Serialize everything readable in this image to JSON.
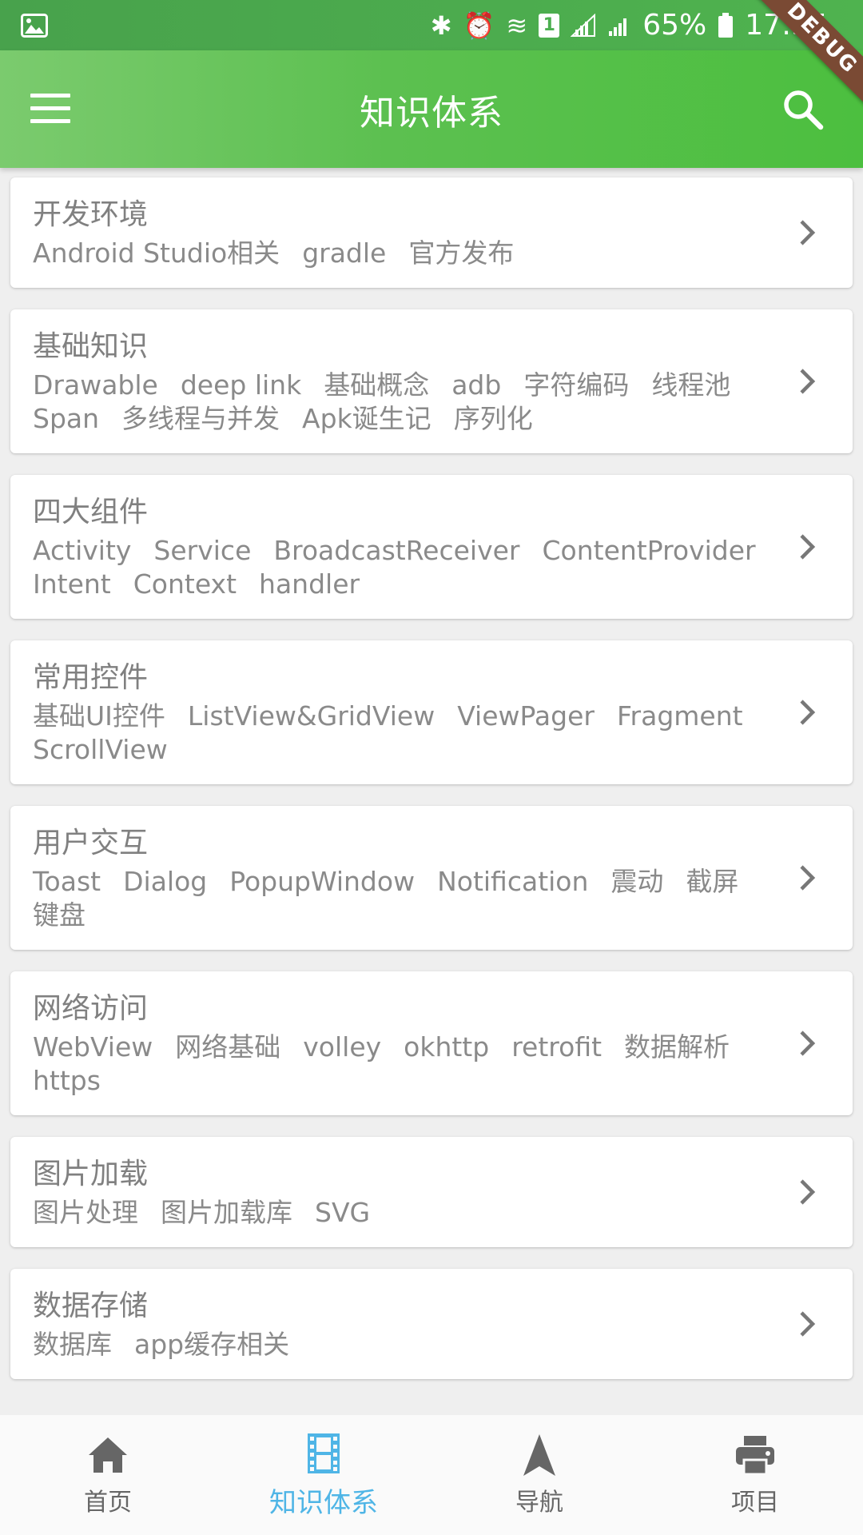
{
  "status_bar": {
    "battery": "65%",
    "time": "17:35",
    "sim_slot": "1"
  },
  "debug_banner": "DEBUG",
  "app_bar": {
    "title": "知识体系"
  },
  "categories": [
    {
      "title": "开发环境",
      "tags": [
        "Android Studio相关",
        "gradle",
        "官方发布"
      ]
    },
    {
      "title": "基础知识",
      "tags": [
        "Drawable",
        "deep link",
        "基础概念",
        "adb",
        "字符编码",
        "线程池",
        "Span",
        "多线程与并发",
        "Apk诞生记",
        "序列化"
      ]
    },
    {
      "title": "四大组件",
      "tags": [
        "Activity",
        "Service",
        "BroadcastReceiver",
        "ContentProvider",
        "Intent",
        "Context",
        "handler"
      ]
    },
    {
      "title": "常用控件",
      "tags": [
        "基础UI控件",
        "ListView&GridView",
        "ViewPager",
        "Fragment",
        "ScrollView"
      ]
    },
    {
      "title": "用户交互",
      "tags": [
        "Toast",
        "Dialog",
        "PopupWindow",
        "Notification",
        "震动",
        "截屏",
        "键盘"
      ]
    },
    {
      "title": "网络访问",
      "tags": [
        "WebView",
        "网络基础",
        "volley",
        "okhttp",
        "retrofit",
        "数据解析",
        "https"
      ]
    },
    {
      "title": "图片加载",
      "tags": [
        "图片处理",
        "图片加载库",
        "SVG"
      ]
    },
    {
      "title": "数据存储",
      "tags": [
        "数据库",
        "app缓存相关"
      ]
    }
  ],
  "bottom_nav": [
    {
      "label": "首页",
      "icon": "home-icon",
      "active": false
    },
    {
      "label": "知识体系",
      "icon": "film-icon",
      "active": true
    },
    {
      "label": "导航",
      "icon": "navigation-arrow-icon",
      "active": false
    },
    {
      "label": "项目",
      "icon": "printer-icon",
      "active": false
    }
  ],
  "colors": {
    "app_bar": "#5cc050",
    "active_tab": "#4fb5e6",
    "inactive_tab": "#666666",
    "debug_ribbon": "#7a4a34"
  }
}
